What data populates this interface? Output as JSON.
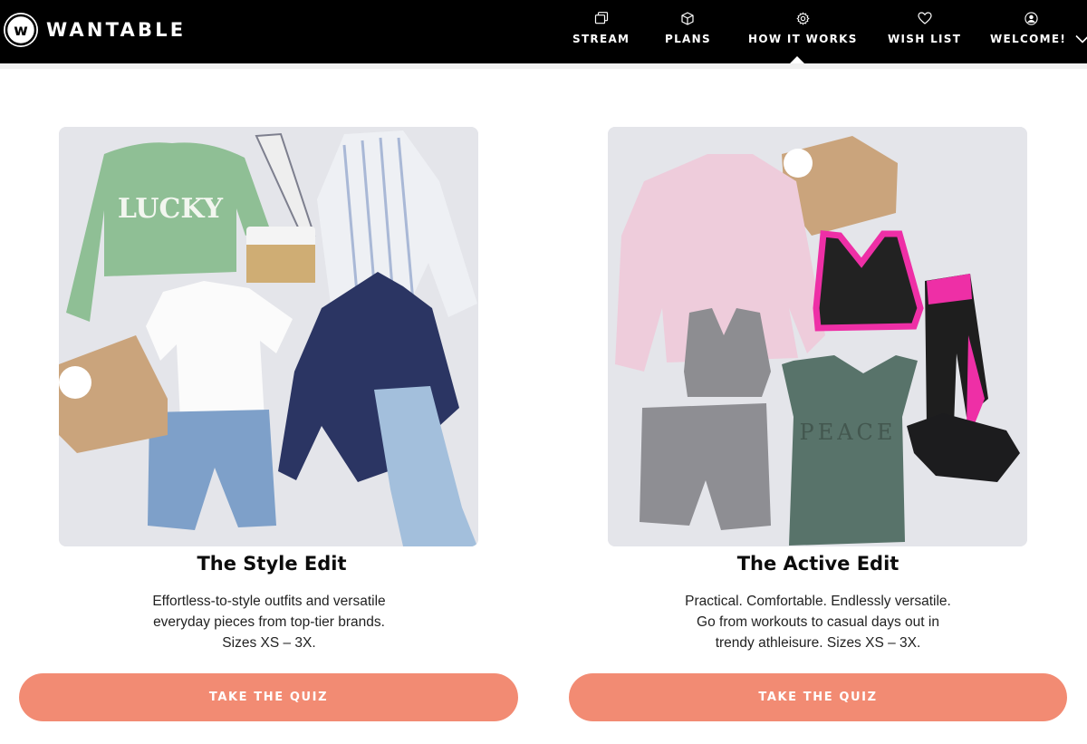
{
  "brand": {
    "name": "WANTABLE",
    "logo_letter": "w"
  },
  "nav": {
    "items": [
      {
        "label": "STREAM",
        "icon": "stream-icon"
      },
      {
        "label": "PLANS",
        "icon": "box-icon"
      },
      {
        "label": "HOW IT WORKS",
        "icon": "gear-icon",
        "active": true
      },
      {
        "label": "WISH LIST",
        "icon": "heart-icon"
      },
      {
        "label": "WELCOME!",
        "icon": "user-icon",
        "dropdown": true
      }
    ]
  },
  "cards": [
    {
      "title": "The Style Edit",
      "description": [
        "Effortless-to-style outfits and versatile",
        "everyday pieces from top-tier brands.",
        "Sizes XS – 3X."
      ],
      "button_label": "TAKE THE QUIZ",
      "image": {
        "sweater_text": "LUCKY"
      }
    },
    {
      "title": "The Active Edit",
      "description": [
        "Practical. Comfortable. Endlessly versatile.",
        "Go from workouts to casual days out in",
        "trendy athleisure. Sizes XS – 3X."
      ],
      "button_label": "TAKE THE QUIZ",
      "image": {
        "tank_text": "PEACE"
      }
    }
  ],
  "colors": {
    "header_bg": "#000000",
    "accent_button": "#f28b73",
    "page_bg": "#ffffff"
  }
}
